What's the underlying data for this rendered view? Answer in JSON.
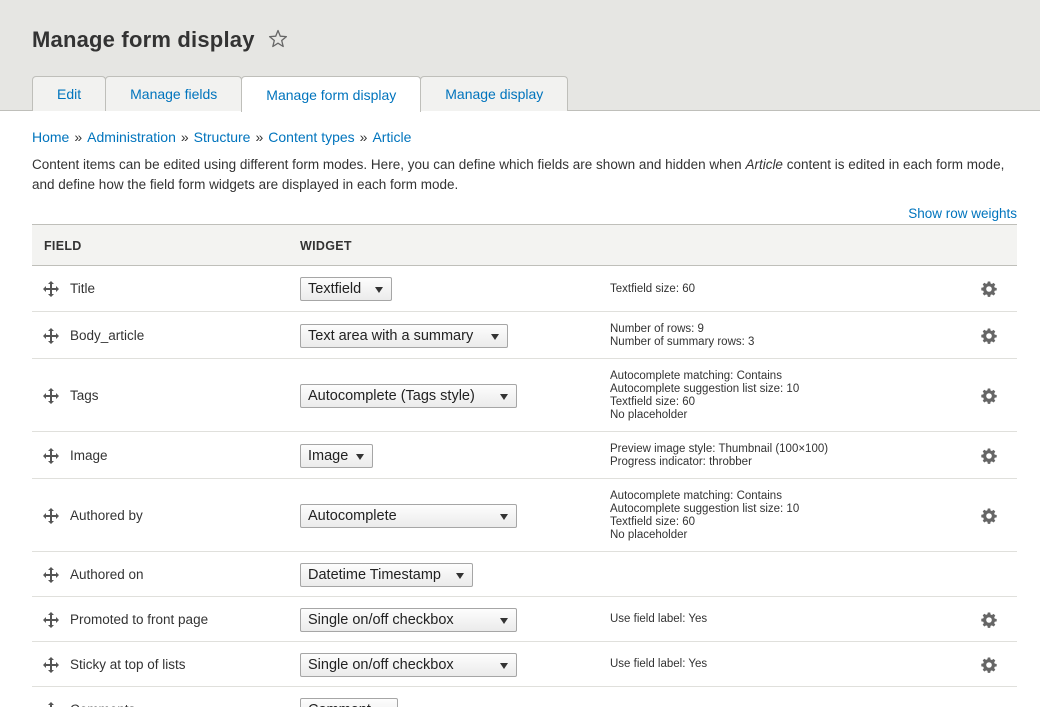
{
  "header": {
    "title": "Manage form display",
    "star_icon": "star-outline-icon",
    "tabs": [
      {
        "label": "Edit",
        "active": false
      },
      {
        "label": "Manage fields",
        "active": false
      },
      {
        "label": "Manage form display",
        "active": true
      },
      {
        "label": "Manage display",
        "active": false
      }
    ]
  },
  "breadcrumb": [
    "Home",
    "Administration",
    "Structure",
    "Content types",
    "Article"
  ],
  "description": {
    "part1": "Content items can be edited using different form modes. Here, you can define which fields are shown and hidden when ",
    "emph": "Article",
    "part2": " content is edited in each form mode, and define how the field form widgets are displayed in each form mode."
  },
  "show_row_weights": "Show row weights",
  "table": {
    "col_field": "FIELD",
    "col_widget": "WIDGET",
    "rows": [
      {
        "field": "Title",
        "widget": "Textfield",
        "summary": [
          "Textfield size: 60"
        ],
        "has_gear": true
      },
      {
        "field": "Body_article",
        "widget": "Text area with a summary",
        "summary": [
          "Number of rows: 9",
          "Number of summary rows: 3"
        ],
        "has_gear": true
      },
      {
        "field": "Tags",
        "widget": "Autocomplete (Tags style)",
        "summary": [
          "Autocomplete matching: Contains",
          "Autocomplete suggestion list size: 10",
          "Textfield size: 60",
          "No placeholder"
        ],
        "has_gear": true
      },
      {
        "field": "Image",
        "widget": "Image",
        "summary": [
          "Preview image style: Thumbnail (100×100)",
          "Progress indicator: throbber"
        ],
        "has_gear": true
      },
      {
        "field": "Authored by",
        "widget": "Autocomplete",
        "summary": [
          "Autocomplete matching: Contains",
          "Autocomplete suggestion list size: 10",
          "Textfield size: 60",
          "No placeholder"
        ],
        "has_gear": true
      },
      {
        "field": "Authored on",
        "widget": "Datetime Timestamp",
        "summary": [],
        "has_gear": false
      },
      {
        "field": "Promoted to front page",
        "widget": "Single on/off checkbox",
        "summary": [
          "Use field label: Yes"
        ],
        "has_gear": true
      },
      {
        "field": "Sticky at top of lists",
        "widget": "Single on/off checkbox",
        "summary": [
          "Use field label: Yes"
        ],
        "has_gear": true
      },
      {
        "field": "Comments",
        "widget": "Comment",
        "summary": [],
        "has_gear": false
      }
    ]
  },
  "colors": {
    "link": "#0074bd",
    "header_bg": "#e6e6e3",
    "table_head_bg": "#f3f3f1"
  }
}
